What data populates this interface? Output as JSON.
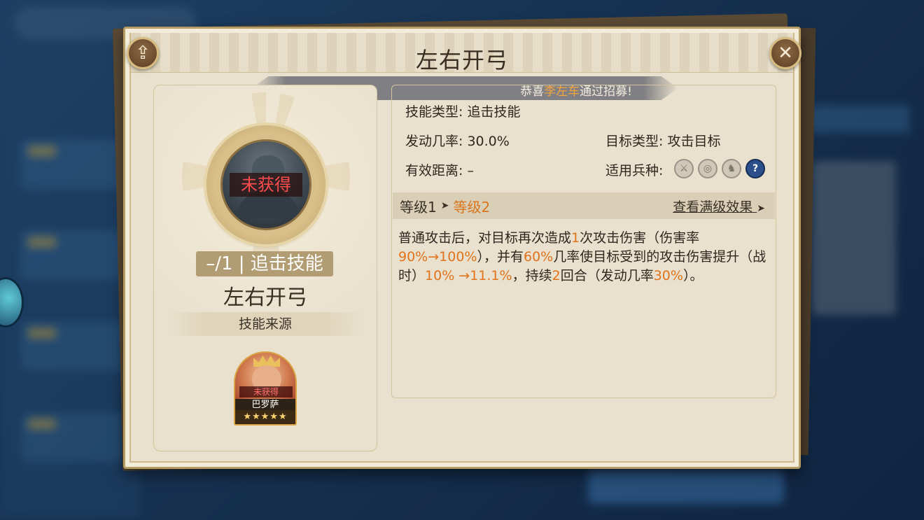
{
  "dialog": {
    "title": "左右开弓"
  },
  "notice": {
    "prefix": "恭喜",
    "name": "李左车",
    "suffix": "通过招募!"
  },
  "skill": {
    "status_overlay": "未获得",
    "tag": "–/1 | 追击技能",
    "name": "左右开弓",
    "source_label": "技能来源"
  },
  "hero": {
    "status": "未获得",
    "name": "巴罗萨",
    "stars": "★★★★★"
  },
  "attributes": {
    "skill_type": "技能类型: 追击技能",
    "trigger_rate": "发动几率: 30.0%",
    "effective_range": "有效距离: –",
    "target_type": "目标类型: 攻击目标",
    "troop_type_label": "适用兵种:"
  },
  "troop_icons": [
    "sword-icon",
    "bow-target-icon",
    "horse-icon",
    "question-icon"
  ],
  "level": {
    "from": "等级1",
    "arrow": "➤",
    "to": "等级2",
    "max_link": "查看满级效果",
    "max_arrow": "➤"
  },
  "description": {
    "p1": "普通攻击后，对目标再次造成",
    "n1": "1",
    "p2": "次攻击伤害（伤害率",
    "n2": "90%",
    "n3": "→100%",
    "p3": "），并有",
    "n4": "60%",
    "p4": "几率使目标受到的攻击伤害提升（战时）",
    "n5": "10% →11.1%",
    "p5": "，持续",
    "n6": "2",
    "p6": "回合（发动几率",
    "n7": "30%",
    "p7": "）。"
  },
  "colors": {
    "highlight": "#e0731c",
    "notice_name": "#f4a640",
    "not_owned": "#ff4d4d"
  }
}
